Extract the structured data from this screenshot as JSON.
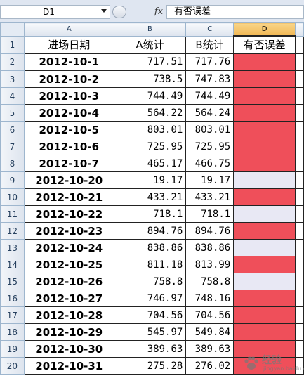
{
  "formula_bar": {
    "name_box": "D1",
    "fx_label": "fx",
    "formula": "有否误差"
  },
  "columns": [
    "A",
    "B",
    "C",
    "D"
  ],
  "header": {
    "row_number": "1",
    "a": "进场日期",
    "b": "A统计",
    "c": "B统计",
    "d": "有否误差"
  },
  "rows": [
    {
      "n": "2",
      "date": "2012-10-1",
      "a": "717.51",
      "b": "717.76",
      "flag": "red"
    },
    {
      "n": "3",
      "date": "2012-10-2",
      "a": "738.5",
      "b": "747.83",
      "flag": "red"
    },
    {
      "n": "4",
      "date": "2012-10-3",
      "a": "744.49",
      "b": "744.49",
      "flag": "red"
    },
    {
      "n": "5",
      "date": "2012-10-4",
      "a": "564.22",
      "b": "564.24",
      "flag": "red"
    },
    {
      "n": "6",
      "date": "2012-10-5",
      "a": "803.01",
      "b": "803.01",
      "flag": "red"
    },
    {
      "n": "7",
      "date": "2012-10-6",
      "a": "725.95",
      "b": "725.95",
      "flag": "red"
    },
    {
      "n": "8",
      "date": "2012-10-7",
      "a": "465.17",
      "b": "466.75",
      "flag": "red"
    },
    {
      "n": "9",
      "date": "2012-10-20",
      "a": "19.17",
      "b": "19.17",
      "flag": "ok"
    },
    {
      "n": "10",
      "date": "2012-10-21",
      "a": "433.21",
      "b": "433.21",
      "flag": "red"
    },
    {
      "n": "11",
      "date": "2012-10-22",
      "a": "718.1",
      "b": "718.1",
      "flag": "ok"
    },
    {
      "n": "12",
      "date": "2012-10-23",
      "a": "894.76",
      "b": "894.76",
      "flag": "red"
    },
    {
      "n": "13",
      "date": "2012-10-24",
      "a": "838.86",
      "b": "838.86",
      "flag": "ok"
    },
    {
      "n": "14",
      "date": "2012-10-25",
      "a": "811.18",
      "b": "813.99",
      "flag": "red"
    },
    {
      "n": "15",
      "date": "2012-10-26",
      "a": "758.8",
      "b": "758.8",
      "flag": "ok"
    },
    {
      "n": "16",
      "date": "2012-10-27",
      "a": "746.97",
      "b": "748.16",
      "flag": "red"
    },
    {
      "n": "17",
      "date": "2012-10-28",
      "a": "704.56",
      "b": "704.56",
      "flag": "red"
    },
    {
      "n": "18",
      "date": "2012-10-29",
      "a": "545.97",
      "b": "549.84",
      "flag": "red"
    },
    {
      "n": "19",
      "date": "2012-10-30",
      "a": "389.63",
      "b": "389.63",
      "flag": "red"
    },
    {
      "n": "20",
      "date": "2012-10-31",
      "a": "275.28",
      "b": "276.02",
      "flag": "red"
    }
  ],
  "colors": {
    "flag_red": "#ef4f5a",
    "flag_ok": "#e8e8f4",
    "selected_header": "#f1b855"
  },
  "watermark": {
    "line1": "经验",
    "line2": "jingyan.baidu.com"
  }
}
